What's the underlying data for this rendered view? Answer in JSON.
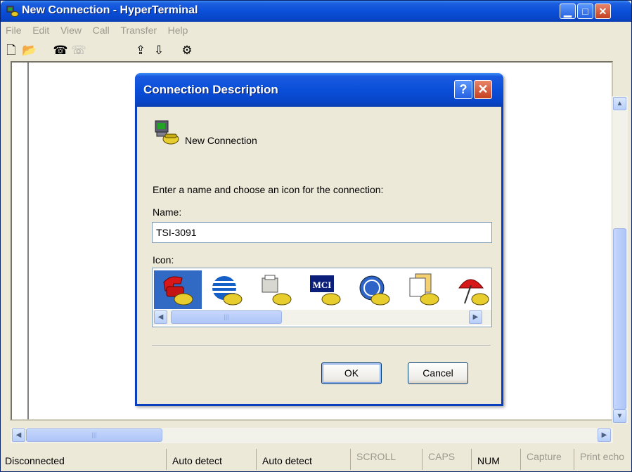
{
  "window": {
    "title": "New Connection - HyperTerminal",
    "icon": "hyperterminal-icon",
    "controls": [
      "minimize",
      "maximize",
      "close"
    ]
  },
  "menu": [
    "File",
    "Edit",
    "View",
    "Call",
    "Transfer",
    "Help"
  ],
  "toolbar": [
    "new-icon",
    "open-icon",
    "call-icon",
    "disconnect-icon",
    "send-icon",
    "receive-icon",
    "properties-icon"
  ],
  "dialog": {
    "title": "Connection Description",
    "help_label": "?",
    "connection_name": "New Connection",
    "prompt": "Enter a name and choose an icon for the connection:",
    "name_label": "Name:",
    "name_value": "TSI-3091",
    "icon_label": "Icon:",
    "icons": [
      "red-phone-icon",
      "att-globe-icon",
      "fax-phone-icon",
      "mci-icon",
      "ge-icon",
      "documents-icon",
      "umbrella-icon"
    ],
    "selected_icon": 0,
    "scroll_marker": "|||",
    "ok_label": "OK",
    "cancel_label": "Cancel"
  },
  "scrollbar": {
    "marker": "|||"
  },
  "statusbar": {
    "status": "Disconnected",
    "emulation": "Auto detect",
    "settings": "Auto detect",
    "scroll": "SCROLL",
    "caps": "CAPS",
    "num": "NUM",
    "capture": "Capture",
    "print": "Print echo"
  }
}
